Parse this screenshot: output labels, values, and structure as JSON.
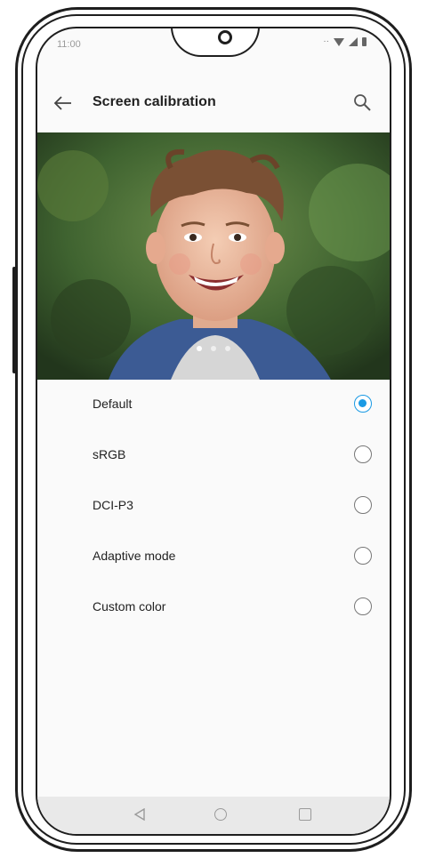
{
  "status_bar": {
    "time": "11:00",
    "icons": [
      "more-dots-icon",
      "wifi-icon",
      "signal-icon",
      "battery-icon"
    ]
  },
  "app_bar": {
    "title": "Screen calibration",
    "back_icon": "back-arrow-icon",
    "search_icon": "search-icon"
  },
  "hero": {
    "image": "smiling-boy-photo",
    "pager": {
      "count": 3,
      "active_index": 0
    }
  },
  "options": [
    {
      "label": "Default",
      "selected": true
    },
    {
      "label": "sRGB",
      "selected": false
    },
    {
      "label": "DCI-P3",
      "selected": false
    },
    {
      "label": "Adaptive mode",
      "selected": false
    },
    {
      "label": "Custom color",
      "selected": false
    }
  ],
  "nav_bar": {
    "icons": [
      "back-triangle-icon",
      "home-circle-icon",
      "recents-square-icon"
    ]
  },
  "colors": {
    "accent": "#1a9ae4",
    "screen_bg": "#fafafa",
    "nav_bg": "#e9e9e9"
  }
}
